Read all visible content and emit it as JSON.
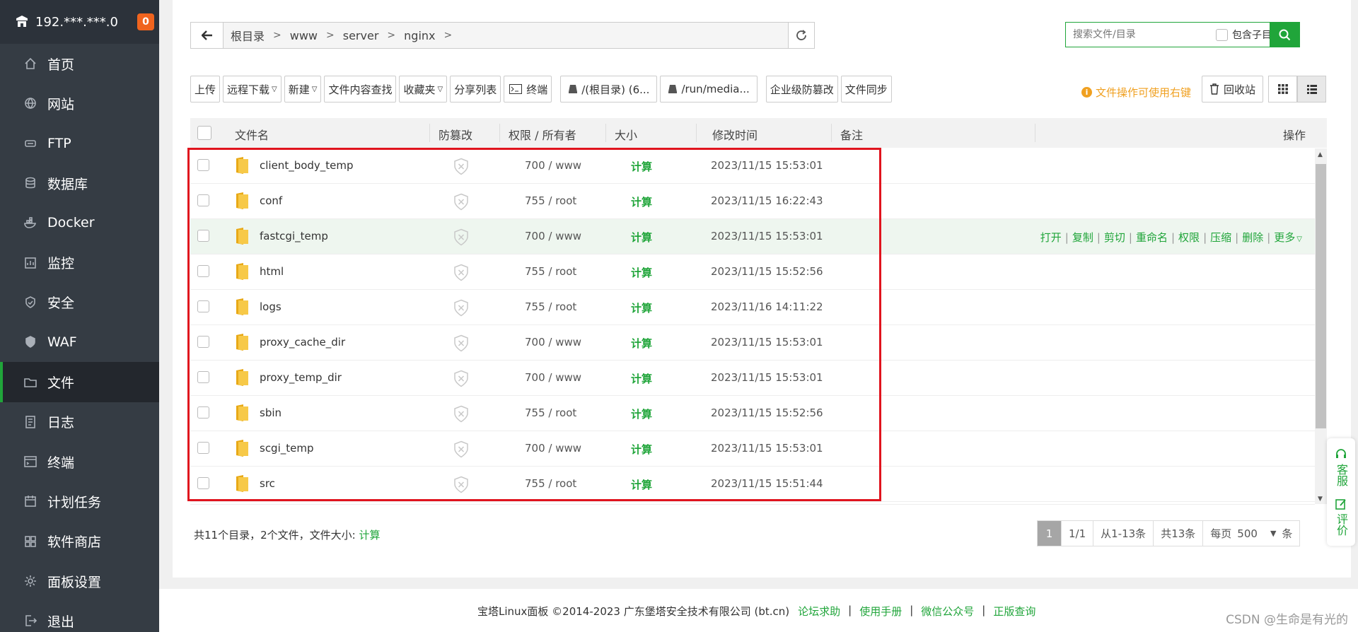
{
  "server": {
    "ip": "192.***.***.0",
    "badge": "0"
  },
  "sidebar": {
    "items": [
      {
        "label": "首页",
        "icon": "home-icon"
      },
      {
        "label": "网站",
        "icon": "globe-icon"
      },
      {
        "label": "FTP",
        "icon": "ftp-icon"
      },
      {
        "label": "数据库",
        "icon": "database-icon"
      },
      {
        "label": "Docker",
        "icon": "docker-icon"
      },
      {
        "label": "监控",
        "icon": "monitor-icon"
      },
      {
        "label": "安全",
        "icon": "shield-icon"
      },
      {
        "label": "WAF",
        "icon": "waf-icon"
      },
      {
        "label": "文件",
        "icon": "folder-icon",
        "active": true
      },
      {
        "label": "日志",
        "icon": "log-icon"
      },
      {
        "label": "终端",
        "icon": "terminal-icon"
      },
      {
        "label": "计划任务",
        "icon": "calendar-icon"
      },
      {
        "label": "软件商店",
        "icon": "apps-icon"
      },
      {
        "label": "面板设置",
        "icon": "gear-icon"
      },
      {
        "label": "退出",
        "icon": "logout-icon"
      }
    ]
  },
  "path": {
    "crumbs": [
      "根目录",
      "www",
      "server",
      "nginx"
    ]
  },
  "search": {
    "placeholder": "搜索文件/目录",
    "include_sub": "包含子目录"
  },
  "toolbar": {
    "upload": "上传",
    "remote_download": "远程下载",
    "new": "新建",
    "content_search": "文件内容查找",
    "favorites": "收藏夹",
    "share_list": "分享列表",
    "terminal": "终端",
    "disk_root": "/(根目录) (6...",
    "disk_media": "/run/media...",
    "tamper": "企业级防篡改",
    "sync": "文件同步"
  },
  "hint": "文件操作可使用右键",
  "recycle": "回收站",
  "table": {
    "headers": {
      "name": "文件名",
      "tamper": "防篡改",
      "perm": "权限 / 所有者",
      "size": "大小",
      "mtime": "修改时间",
      "note": "备注",
      "ops": "操作"
    },
    "rows": [
      {
        "name": "client_body_temp",
        "perm": "700 / www",
        "size": "计算",
        "mtime": "2023/11/15 15:53:01"
      },
      {
        "name": "conf",
        "perm": "755 / root",
        "size": "计算",
        "mtime": "2023/11/15 16:22:43"
      },
      {
        "name": "fastcgi_temp",
        "perm": "700 / www",
        "size": "计算",
        "mtime": "2023/11/15 15:53:01"
      },
      {
        "name": "html",
        "perm": "755 / root",
        "size": "计算",
        "mtime": "2023/11/15 15:52:56"
      },
      {
        "name": "logs",
        "perm": "755 / root",
        "size": "计算",
        "mtime": "2023/11/16 14:11:22"
      },
      {
        "name": "proxy_cache_dir",
        "perm": "700 / www",
        "size": "计算",
        "mtime": "2023/11/15 15:53:01"
      },
      {
        "name": "proxy_temp_dir",
        "perm": "700 / www",
        "size": "计算",
        "mtime": "2023/11/15 15:53:01"
      },
      {
        "name": "sbin",
        "perm": "755 / root",
        "size": "计算",
        "mtime": "2023/11/15 15:52:56"
      },
      {
        "name": "scgi_temp",
        "perm": "700 / www",
        "size": "计算",
        "mtime": "2023/11/15 15:53:01"
      },
      {
        "name": "src",
        "perm": "755 / root",
        "size": "计算",
        "mtime": "2023/11/15 15:51:44"
      }
    ],
    "row_ops": [
      "打开",
      "复制",
      "剪切",
      "重命名",
      "权限",
      "压缩",
      "删除",
      "更多"
    ]
  },
  "summary": {
    "text": "共11个目录，2个文件，文件大小:",
    "link": "计算"
  },
  "pager": {
    "current": "1",
    "pages": "1/1",
    "range": "从1-13条",
    "total": "共13条",
    "per_page_label": "每页",
    "per_page": "500",
    "unit": "条"
  },
  "footer": {
    "copyright": "宝塔Linux面板 ©2014-2023 广东堡塔安全技术有限公司 (bt.cn)",
    "links": [
      "论坛求助",
      "使用手册",
      "微信公众号",
      "正版查询"
    ]
  },
  "float": {
    "service": "客服",
    "review": "评价"
  },
  "watermark": "CSDN @生命是有光的",
  "colors": {
    "accent": "#20a53a",
    "sidebar": "#353c44",
    "highlight": "#e0141e",
    "hint": "#f0a020"
  }
}
